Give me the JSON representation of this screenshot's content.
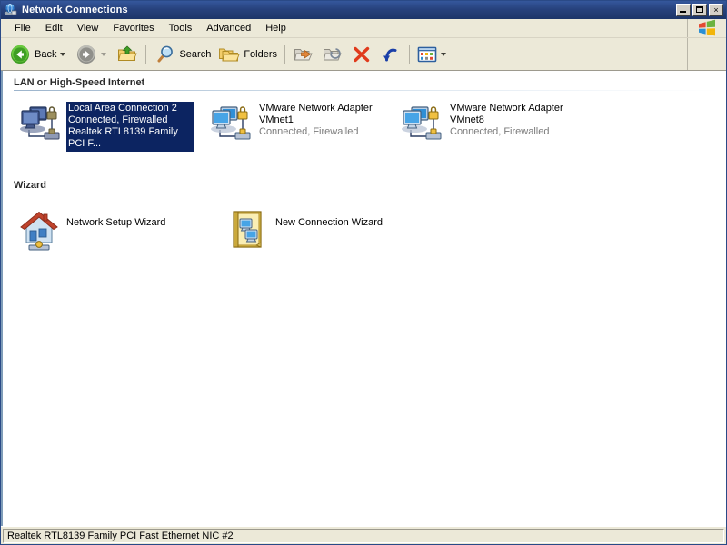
{
  "window": {
    "title": "Network Connections",
    "title_icon": "network-connections-icon",
    "minimize_label": "Minimize",
    "maximize_label": "Maximize",
    "close_label": "Close",
    "close_glyph": "×"
  },
  "menubar": {
    "items": [
      {
        "label": "File"
      },
      {
        "label": "Edit"
      },
      {
        "label": "View"
      },
      {
        "label": "Favorites"
      },
      {
        "label": "Tools"
      },
      {
        "label": "Advanced"
      },
      {
        "label": "Help"
      }
    ],
    "brand_icon": "windows-flag-icon"
  },
  "toolbar": {
    "back_label": "Back",
    "back_icon": "back-arrow-icon",
    "forward_icon": "forward-arrow-icon",
    "up_icon": "up-folder-icon",
    "search_label": "Search",
    "search_icon": "search-icon",
    "folders_label": "Folders",
    "folders_icon": "folders-icon",
    "move_to_icon": "move-to-folder-icon",
    "copy_to_icon": "copy-to-folder-icon",
    "delete_icon": "delete-icon",
    "undo_icon": "undo-icon",
    "views_icon": "views-icon"
  },
  "groups": [
    {
      "header": "LAN or High-Speed Internet",
      "items": [
        {
          "name": "Local Area Connection 2",
          "status": "Connected, Firewalled",
          "device": "Realtek RTL8139 Family PCI F...",
          "icon": "lan-connection-firewalled-icon",
          "selected": true
        },
        {
          "name": "VMware Network Adapter",
          "name2": "VMnet1",
          "status": "Connected, Firewalled",
          "icon": "lan-connection-firewalled-icon",
          "selected": false
        },
        {
          "name": "VMware Network Adapter",
          "name2": "VMnet8",
          "status": "Connected, Firewalled",
          "icon": "lan-connection-firewalled-icon",
          "selected": false
        }
      ]
    },
    {
      "header": "Wizard",
      "items": [
        {
          "name": "Network Setup Wizard",
          "icon": "network-setup-wizard-icon"
        },
        {
          "name": "New Connection Wizard",
          "icon": "new-connection-wizard-icon"
        }
      ]
    }
  ],
  "statusbar": {
    "text": "Realtek RTL8139 Family PCI Fast Ethernet NIC #2"
  },
  "colors": {
    "titlebar": "#27427d",
    "selection": "#0c2461",
    "chrome": "#ece9d8",
    "content": "#ffffff",
    "status_text": "#7b7b7b"
  }
}
